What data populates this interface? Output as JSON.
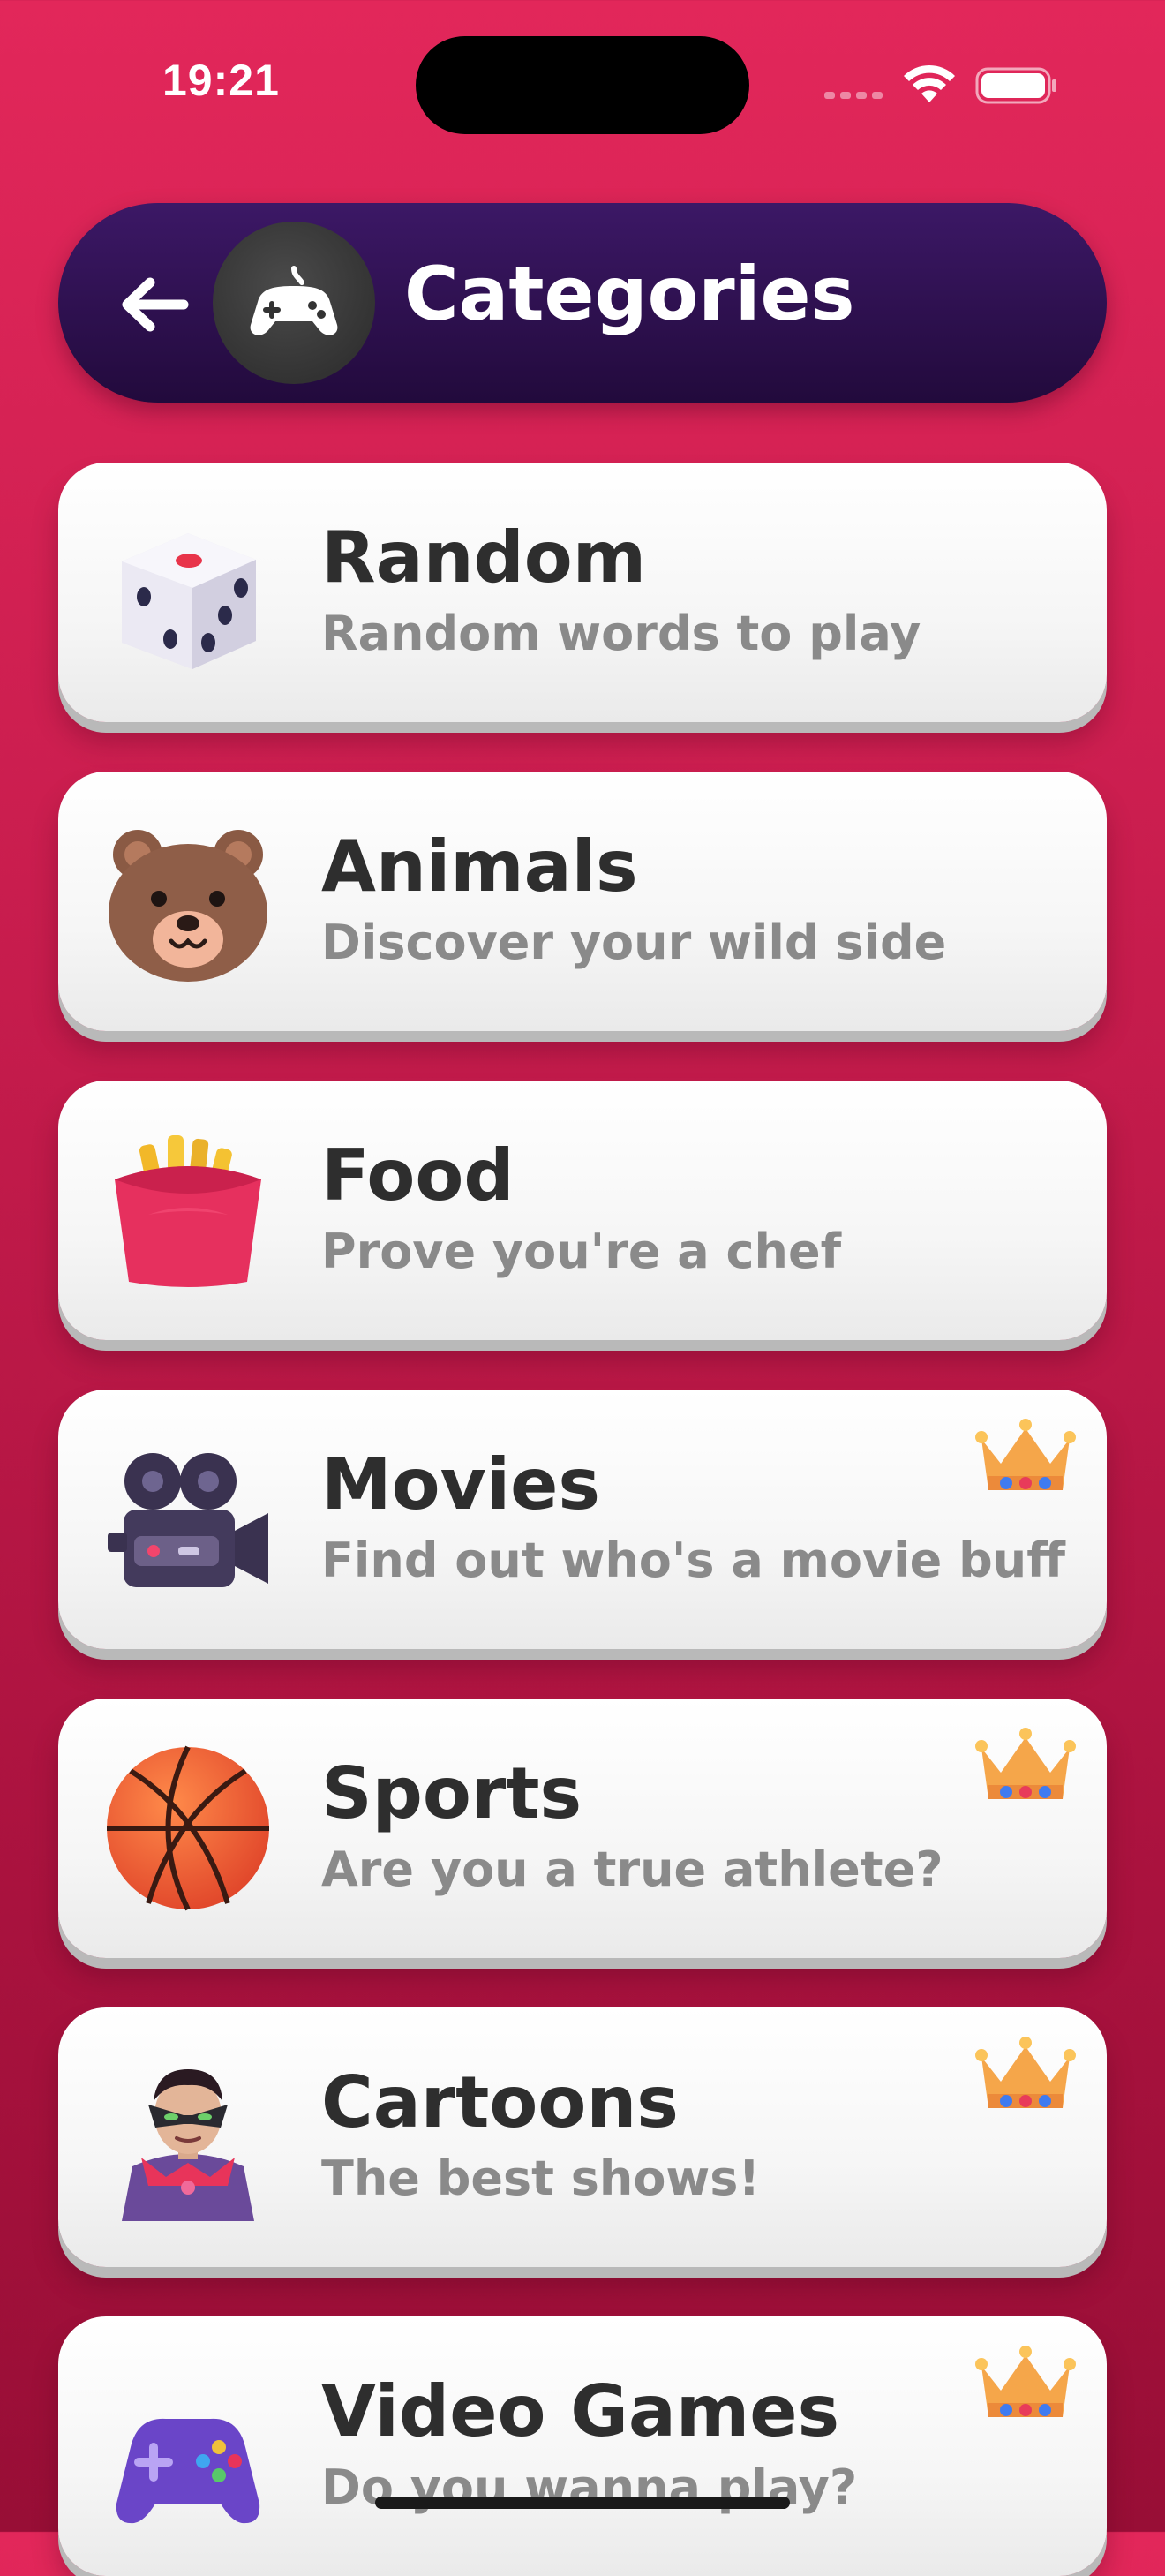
{
  "status_bar": {
    "time": "19:21"
  },
  "header": {
    "title": "Categories",
    "back_icon": "arrow-left-icon",
    "avatar_icon": "gamepad-icon"
  },
  "categories": [
    {
      "title": "Random",
      "subtitle": "Random words to play",
      "icon": "dice-icon",
      "premium": false
    },
    {
      "title": "Animals",
      "subtitle": "Discover your wild side",
      "icon": "bear-face-icon",
      "premium": false
    },
    {
      "title": "Food",
      "subtitle": "Prove you're a chef",
      "icon": "french-fries-icon",
      "premium": false
    },
    {
      "title": "Movies",
      "subtitle": "Find out who's a movie buff",
      "icon": "movie-camera-icon",
      "premium": true
    },
    {
      "title": "Sports",
      "subtitle": "Are you a true athlete?",
      "icon": "basketball-icon",
      "premium": true
    },
    {
      "title": "Cartoons",
      "subtitle": "The best shows!",
      "icon": "supervillain-icon",
      "premium": true
    },
    {
      "title": "Video Games",
      "subtitle": "Do you wanna play?",
      "icon": "video-game-controller-icon",
      "premium": true
    }
  ],
  "colors": {
    "background_top": "#e2275a",
    "background_bottom": "#980e36",
    "header": "#2d1050",
    "card": "#ffffff",
    "title_text": "#2e2e2e",
    "subtitle_text": "#8a8a8a"
  }
}
